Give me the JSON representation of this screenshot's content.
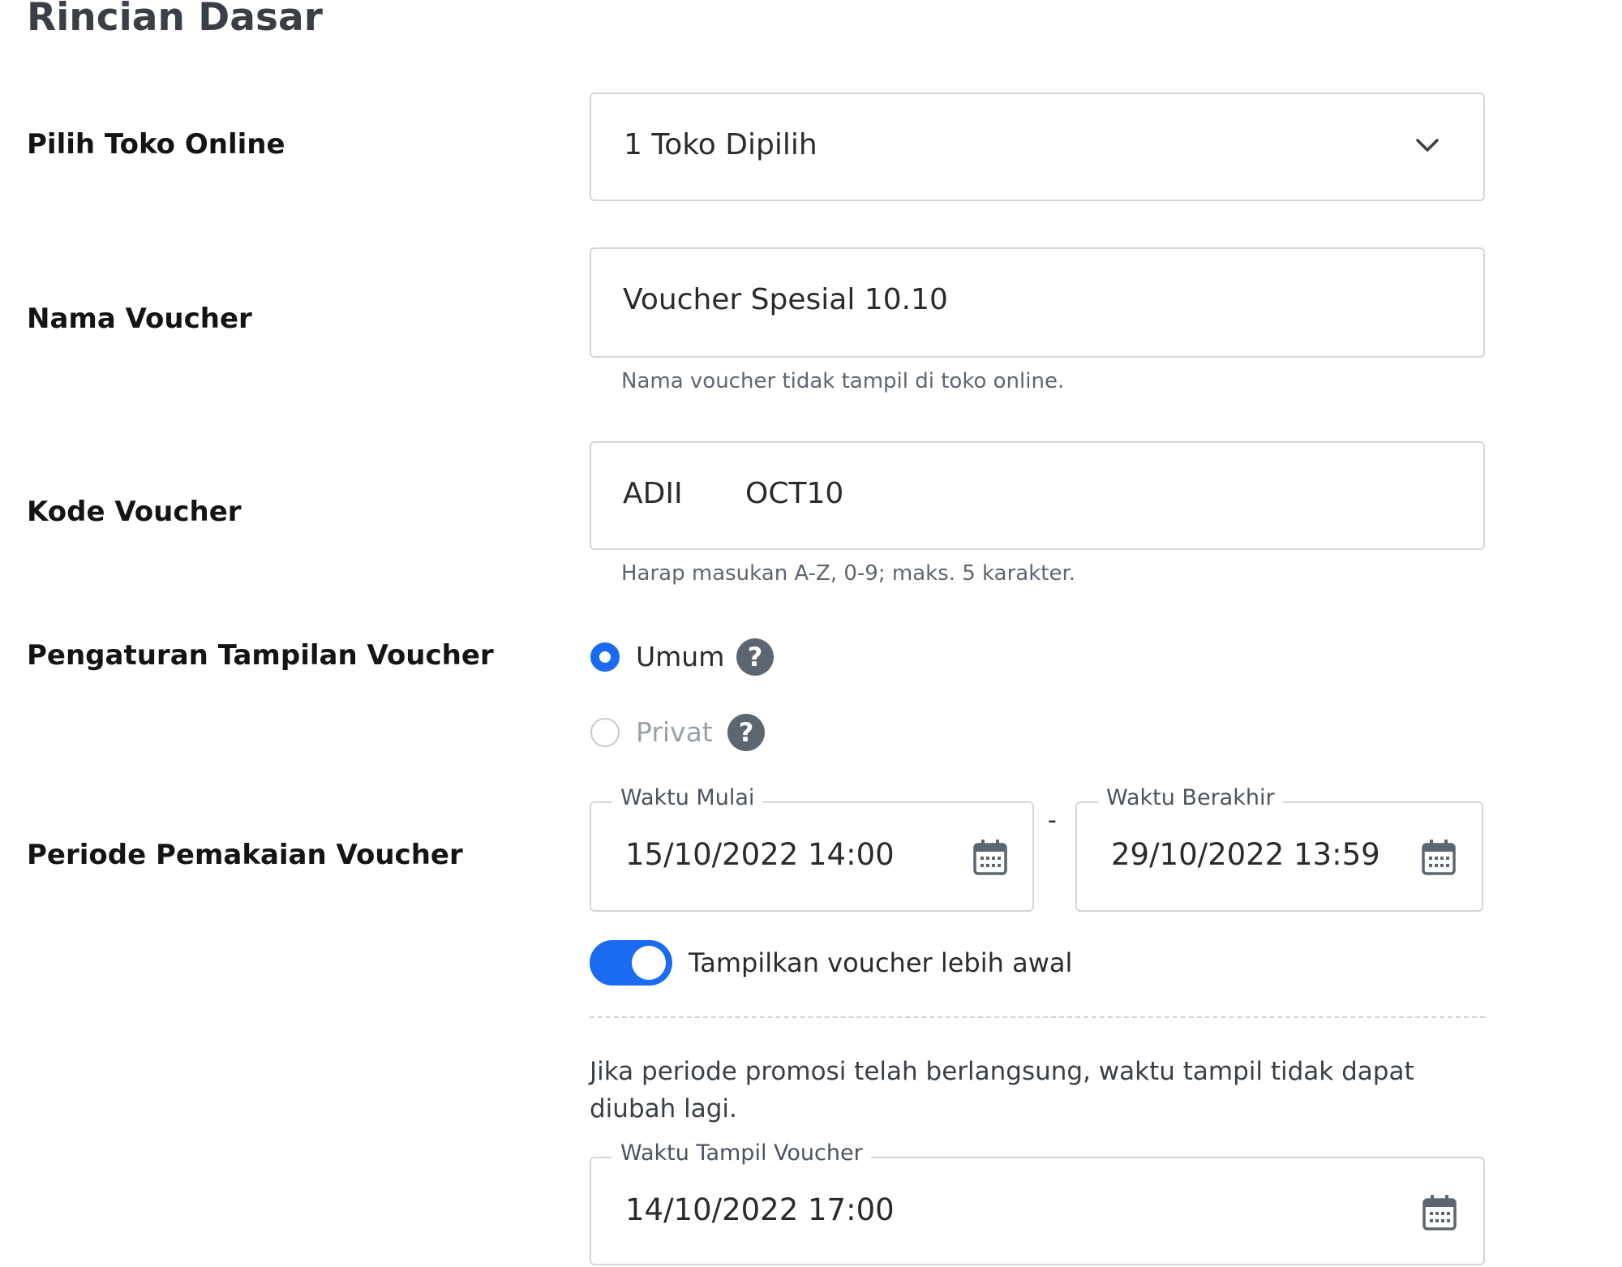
{
  "section": {
    "title": "Rincian Dasar"
  },
  "store": {
    "label": "Pilih Toko Online",
    "value": "1 Toko Dipilih"
  },
  "voucher_name": {
    "label": "Nama Voucher",
    "value": "Voucher Spesial 10.10",
    "hint": "Nama voucher tidak tampil di toko online."
  },
  "voucher_code": {
    "label": "Kode Voucher",
    "prefix": "ADII",
    "value": "OCT10",
    "hint": "Harap masukan A-Z, 0-9; maks. 5 karakter."
  },
  "display_setting": {
    "label": "Pengaturan Tampilan Voucher",
    "options": [
      {
        "label": "Umum",
        "selected": true
      },
      {
        "label": "Privat",
        "selected": false
      }
    ]
  },
  "period": {
    "label": "Periode Pemakaian Voucher",
    "start": {
      "legend": "Waktu Mulai",
      "value": "15/10/2022 14:00"
    },
    "separator": "-",
    "end": {
      "legend": "Waktu Berakhir",
      "value": "29/10/2022 13:59"
    }
  },
  "early_display": {
    "toggle_label": "Tampilkan voucher lebih awal",
    "enabled": true,
    "note_line1": "Jika periode promosi telah berlangsung, waktu tampil tidak dapat",
    "note_line2": "diubah lagi.",
    "field": {
      "legend": "Waktu Tampil Voucher",
      "value": "14/10/2022 17:00"
    }
  },
  "colors": {
    "accent": "#1a6af2",
    "border": "#d3d6db",
    "help_icon": "#5c6670"
  },
  "icons": {
    "dropdown": "chevron-down-icon",
    "calendar": "calendar-icon",
    "help": "question-circle-icon"
  }
}
